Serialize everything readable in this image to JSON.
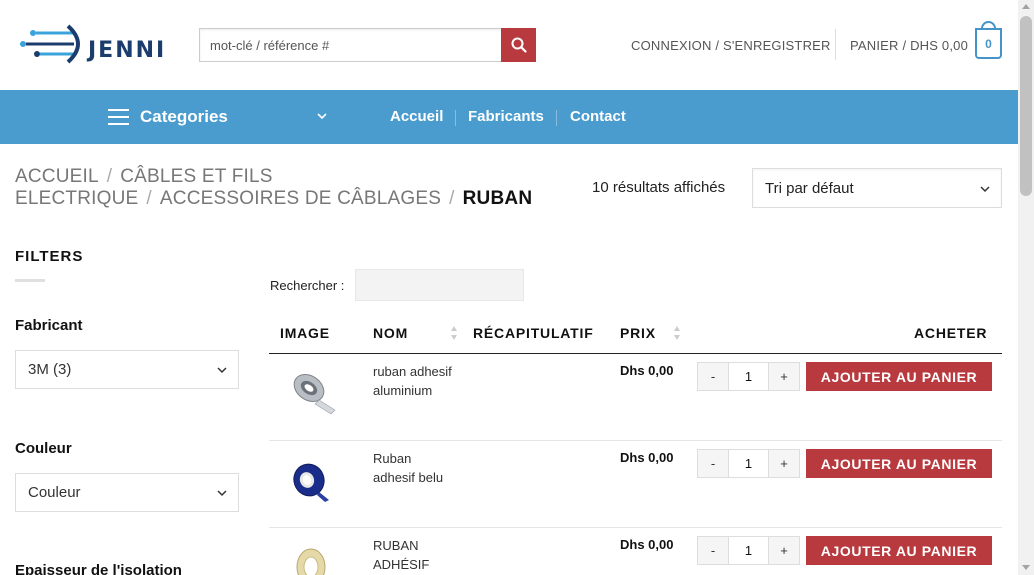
{
  "header": {
    "logo_text": "JENNI",
    "search_placeholder": "mot-clé / référence #",
    "login_label": "CONNEXION / S'ENREGISTRER",
    "cart_label": "PANIER / DHS 0,00",
    "cart_count": "0",
    "accent_color": "#4a9ccf",
    "button_color": "#b83a3e"
  },
  "nav": {
    "categories_label": "Categories",
    "items": [
      "Accueil",
      "Fabricants",
      "Contact"
    ]
  },
  "breadcrumb": {
    "items": [
      "ACCUEIL",
      "CÂBLES ET FILS ELECTRIQUE",
      "ACCESSOIRES DE CÂBLAGES"
    ],
    "current": "RUBAN",
    "separator": "/"
  },
  "results_text": "10 résultats affichés",
  "sort": {
    "selected": "Tri par défaut"
  },
  "sidebar": {
    "title": "FILTERS",
    "filters": [
      {
        "label": "Fabricant",
        "selected": "3M (3)"
      },
      {
        "label": "Couleur",
        "selected": "Couleur"
      },
      {
        "label": "Epaisseur de l'isolation"
      }
    ]
  },
  "table": {
    "search_label": "Rechercher :",
    "columns": [
      "IMAGE",
      "NOM",
      "RÉCAPITULATIF",
      "PRIX",
      "ACHETER"
    ],
    "add_label": "AJOUTER AU PANIER",
    "rows": [
      {
        "name": "ruban adhesif aluminium",
        "price": "Dhs 0,00",
        "qty": "1",
        "image": "aluminium-tape-roll"
      },
      {
        "name": "Ruban adhesif belu",
        "price": "Dhs 0,00",
        "qty": "1",
        "image": "blue-tape-roll"
      },
      {
        "name": "RUBAN ADHÉSIF",
        "price": "Dhs 0,00",
        "qty": "1",
        "image": "beige-tape-roll"
      }
    ],
    "minus": "-",
    "plus": "+"
  }
}
